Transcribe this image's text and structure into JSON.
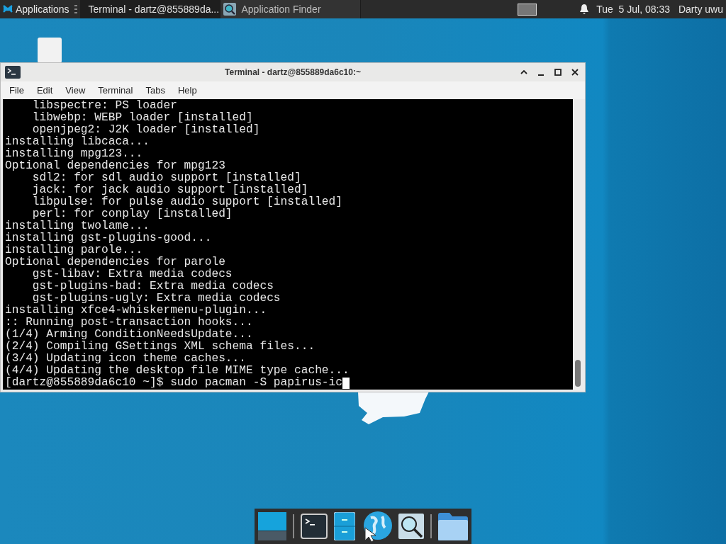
{
  "panel": {
    "menu_label": "Applications",
    "tasks": [
      {
        "title": "Terminal - dartz@855889da...",
        "selected": true,
        "kind": "terminal"
      },
      {
        "title": "Application Finder",
        "selected": false,
        "kind": "finder"
      }
    ],
    "clock": "Tue  5 Jul, 08:33",
    "user": "Darty uwu"
  },
  "window": {
    "title": "Terminal - dartz@855889da6c10:~",
    "menu": [
      "File",
      "Edit",
      "View",
      "Terminal",
      "Tabs",
      "Help"
    ],
    "lines": [
      "    libspectre: PS loader",
      "    libwebp: WEBP loader [installed]",
      "    openjpeg2: J2K loader [installed]",
      "installing libcaca...",
      "installing mpg123...",
      "Optional dependencies for mpg123",
      "    sdl2: for sdl audio support [installed]",
      "    jack: for jack audio support [installed]",
      "    libpulse: for pulse audio support [installed]",
      "    perl: for conplay [installed]",
      "installing twolame...",
      "installing gst-plugins-good...",
      "installing parole...",
      "Optional dependencies for parole",
      "    gst-libav: Extra media codecs",
      "    gst-plugins-bad: Extra media codecs",
      "    gst-plugins-ugly: Extra media codecs",
      "installing xfce4-whiskermenu-plugin...",
      ":: Running post-transaction hooks...",
      "(1/4) Arming ConditionNeedsUpdate...",
      "(2/4) Compiling GSettings XML schema files...",
      "(3/4) Updating icon theme caches...",
      "(4/4) Updating the desktop file MIME type cache..."
    ],
    "prompt": "[dartz@855889da6c10 ~]$ sudo pacman -S papirus-ic"
  }
}
